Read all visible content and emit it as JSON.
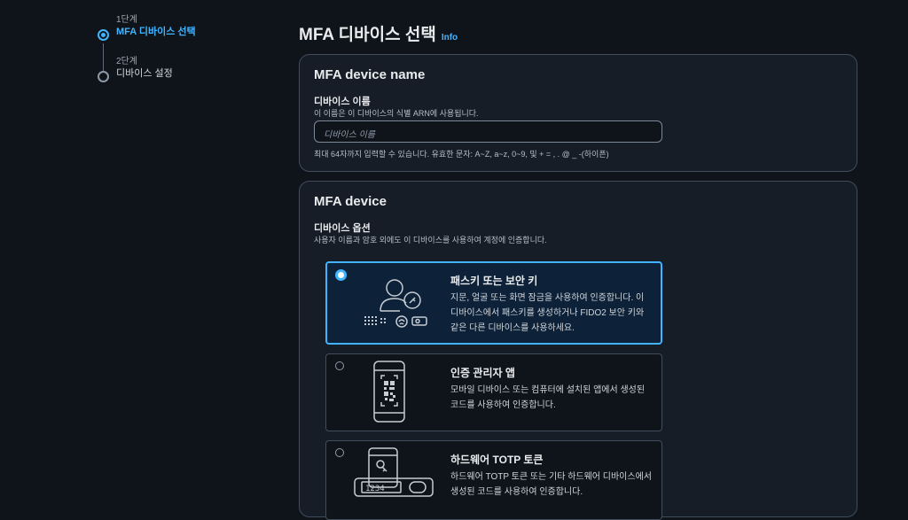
{
  "steps": [
    {
      "number": "1단계",
      "title": "MFA 디바이스 선택",
      "active": true
    },
    {
      "number": "2단계",
      "title": "디바이스 설정",
      "active": false
    }
  ],
  "page": {
    "title": "MFA 디바이스 선택",
    "info_link": "Info"
  },
  "name_panel": {
    "header": "MFA device name",
    "field_label": "디바이스 이름",
    "field_description": "이 이름은 이 디바이스의 식별 ARN에 사용됩니다.",
    "input_value": "",
    "input_placeholder": "디바이스 이름",
    "constraint": "최대 64자까지 입력할 수 있습니다. 유효한 문자: A~Z, a~z, 0~9, 및 + = , . @ _ -(하이픈)"
  },
  "device_panel": {
    "header": "MFA device",
    "field_label": "디바이스 옵션",
    "field_description": "사용자 이름과 암호 외에도 이 디바이스를 사용하여 계정에 인증합니다.",
    "options": [
      {
        "title": "패스키 또는 보안 키",
        "description": "지문, 얼굴 또는 화면 잠금을 사용하여 인증합니다. 이 디바이스에서 패스키를 생성하거나 FIDO2 보안 키와 같은 다른 디바이스를 사용하세요.",
        "selected": true,
        "icon": "passkey-icon"
      },
      {
        "title": "인증 관리자 앱",
        "description": "모바일 디바이스 또는 컴퓨터에 설치된 앱에서 생성된 코드를 사용하여 인증합니다.",
        "selected": false,
        "icon": "authenticator-app-icon"
      },
      {
        "title": "하드웨어 TOTP 토큰",
        "description": "하드웨어 TOTP 토큰 또는 기타 하드웨어 디바이스에서 생성된 코드를 사용하여 인증합니다.",
        "selected": false,
        "icon": "hardware-token-icon",
        "token_display": "1234"
      }
    ]
  },
  "colors": {
    "background": "#0f141a",
    "panel": "#161d26",
    "accent": "#42b4ff",
    "selected_tile": "#0d2238"
  }
}
